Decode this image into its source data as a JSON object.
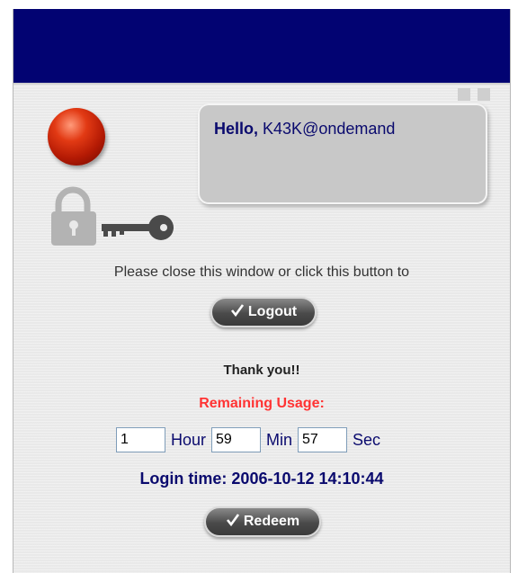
{
  "greeting": {
    "prefix": "Hello,",
    "username": "K43K@ondemand"
  },
  "prompt_text": "Please close this window or click this button to",
  "logout_button": {
    "label": "Logout"
  },
  "thanks_text": "Thank you!!",
  "remaining_label": "Remaining Usage:",
  "timer": {
    "hour_value": "1",
    "hour_unit": "Hour",
    "min_value": "59",
    "min_unit": "Min",
    "sec_value": "57",
    "sec_unit": "Sec"
  },
  "login_time": "Login time: 2006-10-12 14:10:44",
  "redeem_button": {
    "label": "Redeem"
  },
  "colors": {
    "header": "#020372",
    "status_light": "#d42a0a",
    "remaining": "#ff3333",
    "text_navy": "#0a0a6e"
  },
  "icons": {
    "status": "red-status-light-icon",
    "lock": "padlock-icon",
    "key": "key-icon",
    "check": "checkmark-icon"
  }
}
